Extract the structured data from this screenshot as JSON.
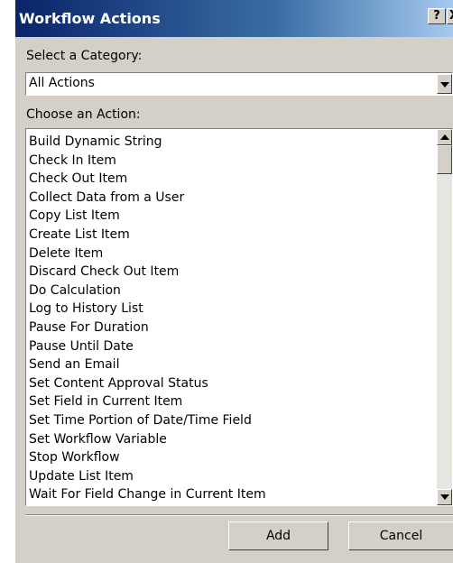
{
  "dialog": {
    "title": "Workflow Actions",
    "help_label": "?",
    "close_label": "X"
  },
  "category": {
    "label": "Select a Category:",
    "value": "All Actions"
  },
  "actions": {
    "label": "Choose an Action:",
    "items": [
      "Build Dynamic String",
      "Check In Item",
      "Check Out Item",
      "Collect Data from a User",
      "Copy List Item",
      "Create List Item",
      "Delete Item",
      "Discard Check Out Item",
      "Do Calculation",
      "Log to History List",
      "Pause For Duration",
      "Pause Until Date",
      "Send an Email",
      "Set Content Approval Status",
      "Set Field in Current Item",
      "Set Time Portion of Date/Time Field",
      "Set Workflow Variable",
      "Stop Workflow",
      "Update List Item",
      "Wait For Field Change in Current Item"
    ]
  },
  "buttons": {
    "add": "Add",
    "cancel": "Cancel"
  },
  "colors": {
    "titlebar_start": "#0a246a",
    "titlebar_end": "#a6caf0",
    "dialog_face": "#d4d0c8"
  }
}
